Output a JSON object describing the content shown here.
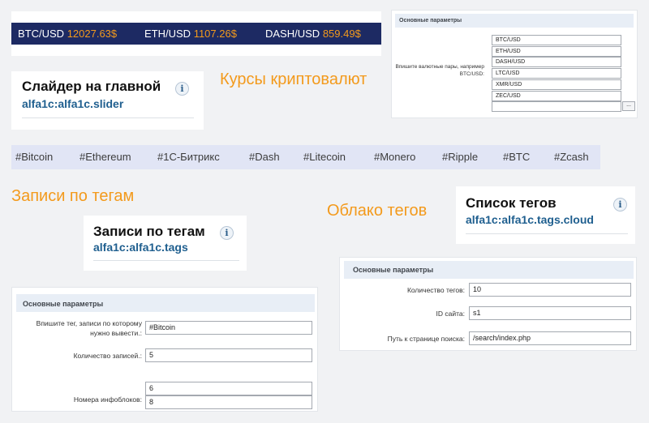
{
  "ticker": {
    "btc_label": "BTC/USD",
    "btc_price": "12027.63$",
    "eth_label": "ETH/USD",
    "eth_price": "1107.26$",
    "dash_label": "DASH/USD",
    "dash_price": "859.49$"
  },
  "crypto_heading": "Курсы криптовалют",
  "slider": {
    "title": "Слайдер на главной",
    "code": "alfa1c:alfa1c.slider"
  },
  "rates_panel": {
    "header": "Основные параметры",
    "label": "Впишите валютные пары, например BTC/USD:",
    "pairs": [
      "BTC/USD",
      "ETH/USD",
      "DASH/USD",
      "LTC/USD",
      "XMR/USD",
      "ZEC/USD",
      ""
    ],
    "add_button": "..."
  },
  "tags_bar": {
    "tags": [
      "#Bitcoin",
      "#Ethereum",
      "#1С-Битрикс",
      "#Dash",
      "#Litecoin",
      "#Monero",
      "#Ripple",
      "#BTC",
      "#Zcash"
    ]
  },
  "tag_posts_heading": "Записи по тегам",
  "tag_cloud_heading": "Облако тегов",
  "tag_posts": {
    "title": "Записи по тегам",
    "code": "alfa1c:alfa1c.tags"
  },
  "tags_list": {
    "title": "Список тегов",
    "code": "alfa1c:alfa1c.tags.cloud"
  },
  "tag_posts_panel": {
    "header": "Основные параметры",
    "tag_label": "Впишите тег, записи по которому нужно вывести.:",
    "tag_value": "#Bitcoin",
    "count_label": "Количество записей.:",
    "count_value": "5",
    "iblocks_label": "Номера инфоблоков:",
    "iblock_values": [
      "6",
      "8"
    ]
  },
  "cloud_panel": {
    "header": "Основные параметры",
    "count_label": "Количество тегов:",
    "count_value": "10",
    "site_label": "ID сайта:",
    "site_value": "s1",
    "path_label": "Путь к странице поиска:",
    "path_value": "/search/index.php"
  },
  "info_icon_glyph": "i"
}
